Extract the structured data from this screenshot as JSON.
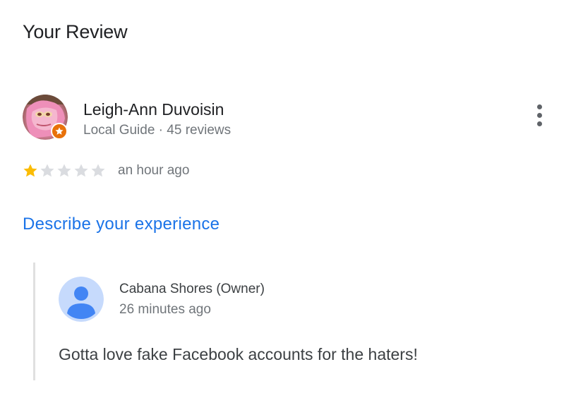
{
  "section": {
    "title": "Your Review"
  },
  "review": {
    "author_name": "Leigh-Ann Duvoisin",
    "author_meta": "Local Guide · 45 reviews",
    "badge_icon": "local-guide-star-icon",
    "rating": 1,
    "max_rating": 5,
    "time_ago": "an hour ago",
    "menu_icon": "more-vert-icon"
  },
  "describe_link": "Describe your experience",
  "owner_reply": {
    "name": "Cabana Shores (Owner)",
    "time_ago": "26 minutes ago",
    "text": "Gotta love fake Facebook accounts for the haters!",
    "avatar_icon": "default-person-avatar-icon"
  },
  "colors": {
    "link": "#1a73e8",
    "star_filled": "#fbbc04",
    "star_empty": "#dadce0",
    "badge": "#e8710a",
    "owner_avatar_bg": "#c6dafc",
    "owner_avatar_fg": "#4285f4",
    "reply_border": "#e0e0e0"
  }
}
